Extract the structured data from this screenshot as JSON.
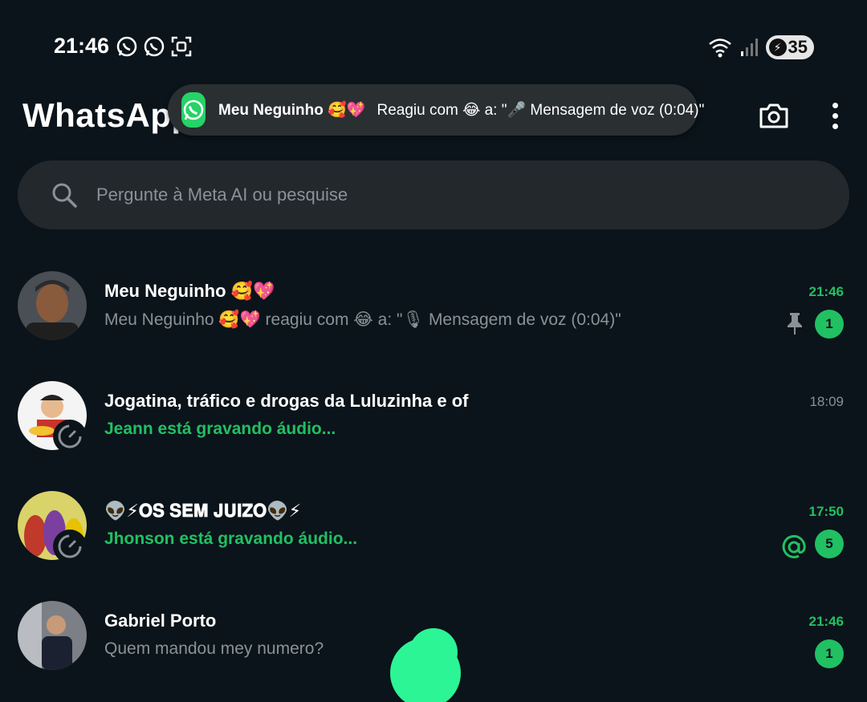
{
  "status_bar": {
    "time": "21:46",
    "battery": "35",
    "icons": [
      "whatsapp-icon",
      "whatsapp-icon",
      "screenshot-icon",
      "wifi-icon",
      "signal-icon",
      "battery-icon"
    ]
  },
  "app_bar": {
    "title": "WhatsApp",
    "camera_icon": "camera-icon",
    "menu_icon": "more-vertical-icon"
  },
  "toast": {
    "sender": "Meu Neguinho 🥰💖",
    "message": "Reagiu com 😂 a: \"🎤 Mensagem de voz (0:04)\""
  },
  "search": {
    "placeholder": "Pergunte à Meta AI ou pesquise"
  },
  "chats": [
    {
      "name": "Meu Neguinho 🥰💖",
      "preview": "Meu Neguinho 🥰💖 reagiu com 😂 a: \"🎙 Mensagem de voz (0:04)\"",
      "time": "21:46",
      "unread": "1",
      "pinned": true
    },
    {
      "name": "Jogatina, tráfico e drogas da Luluzinha e of",
      "preview": "Jeann está gravando áudio...",
      "time": "18:09"
    },
    {
      "name": "👽⚡𝐎𝐒 𝐒𝐄𝐌 𝐉𝐔𝐈𝐙𝐎👽⚡",
      "preview": "Jhonson está gravando áudio...",
      "time": "17:50",
      "unread": "5",
      "mention": true
    },
    {
      "name": "Gabriel Porto",
      "preview": "Quem mandou mey numero?",
      "time": "21:46",
      "unread": "1"
    }
  ],
  "colors": {
    "background": "#0b141a",
    "accent_green": "#21c063",
    "search_bg": "#23282c",
    "muted_text": "#8a9297"
  }
}
